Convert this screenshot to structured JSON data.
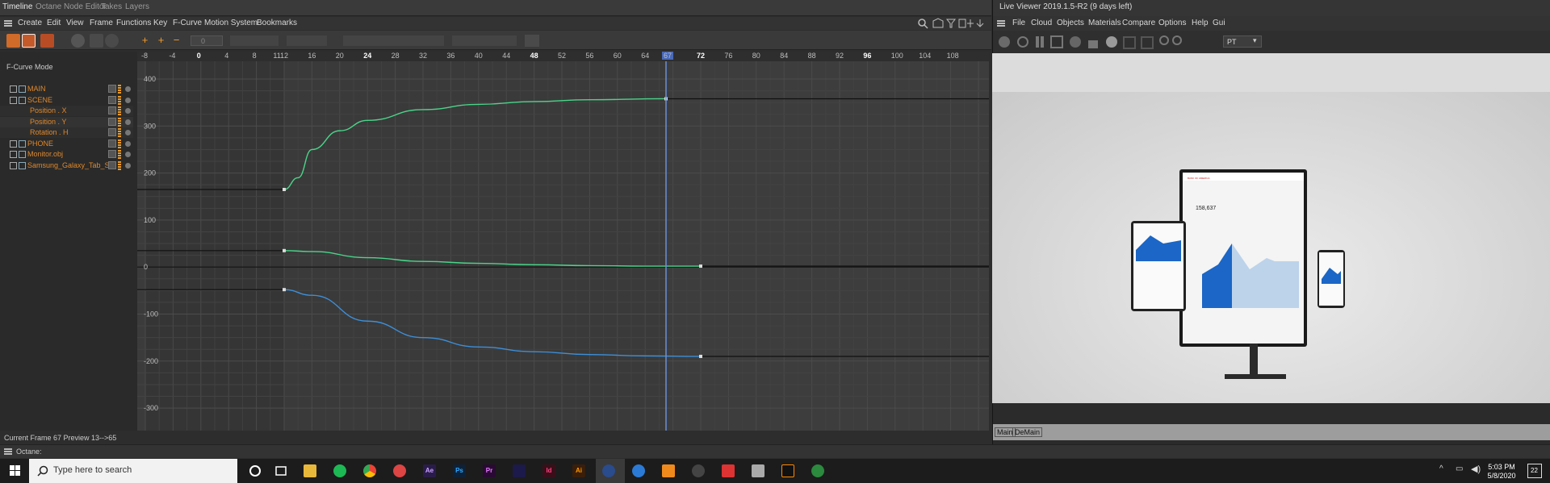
{
  "tabs": [
    "Timeline",
    "Octane Node Editor",
    "Takes",
    "Layers"
  ],
  "timeline_menu": [
    "Create",
    "Edit",
    "View",
    "Frame",
    "Functions",
    "Key",
    "F-Curve",
    "Motion System",
    "Bookmarks"
  ],
  "fcurve_mode": "F-Curve Mode",
  "tree": [
    {
      "label": "MAIN",
      "indent": 1
    },
    {
      "label": "SCENE",
      "indent": 1
    },
    {
      "label": "Position . X",
      "indent": 2
    },
    {
      "label": "Position . Y",
      "indent": 2
    },
    {
      "label": "Rotation . H",
      "indent": 2
    },
    {
      "label": "PHONE",
      "indent": 1
    },
    {
      "label": "Monitor.obj",
      "indent": 1
    },
    {
      "label": "Samsung_Galaxy_Tab_S6",
      "indent": 1
    }
  ],
  "ruler_ticks": [
    "-8",
    "-4",
    "0",
    "4",
    "8",
    "12",
    "16",
    "20",
    "24",
    "28",
    "32",
    "36",
    "40",
    "44",
    "48",
    "52",
    "56",
    "60",
    "64",
    "67",
    "72",
    "76",
    "80",
    "84",
    "88",
    "92",
    "96",
    "100",
    "104",
    "108",
    "11"
  ],
  "ruler_bold": [
    "0",
    "24",
    "48",
    "72",
    "96"
  ],
  "y_labels": [
    "400",
    "300",
    "200",
    "100",
    "0",
    "-100",
    "-200",
    "-300"
  ],
  "current_frame_marker": "67",
  "status_text": "Current Frame  67  Preview  13-->65",
  "octane_label": "Octane:",
  "viewer_title": "Live Viewer 2019.1.5-R2 (9 days left)",
  "viewer_menu": [
    "File",
    "Cloud",
    "Objects",
    "Materials",
    "Compare",
    "Options",
    "Help",
    "Gui"
  ],
  "render_dropdown": "PT",
  "render_tags": [
    "Main",
    "DeMain"
  ],
  "search_placeholder": "Type here to search",
  "clock_time": "5:03 PM",
  "clock_date": "5/8/2020",
  "notification_count": "22",
  "toolbar_field": "0",
  "dashboard_value": "158,637",
  "dashboard_brand": "BANK OF AMERICA",
  "taskbar_apps": [
    "Ae",
    "Ps",
    "Pr",
    "Id",
    "Ai"
  ],
  "colors": {
    "curve_green": "#4ad58a",
    "curve_blue": "#3d8fd9",
    "label_orange": "#e0882a",
    "playhead": "#6a8fd8"
  },
  "chart_data": {
    "type": "line",
    "x_range": [
      -8,
      112
    ],
    "y_range": [
      -300,
      400
    ],
    "series": [
      {
        "x": [
          12,
          14,
          16,
          20,
          24,
          32,
          40,
          48,
          56,
          67
        ],
        "y": [
          165,
          190,
          250,
          290,
          312,
          335,
          346,
          352,
          356,
          358
        ]
      },
      {
        "x": [
          12,
          16,
          24,
          32,
          40,
          48,
          56,
          64,
          72
        ],
        "y": [
          35,
          33,
          20,
          12,
          8,
          5,
          3,
          2,
          2
        ]
      },
      {
        "x": [
          12,
          16,
          24,
          32,
          40,
          48,
          56,
          64,
          72
        ],
        "y": [
          -48,
          -60,
          -115,
          -150,
          -170,
          -180,
          -186,
          -189,
          -190
        ]
      }
    ]
  }
}
